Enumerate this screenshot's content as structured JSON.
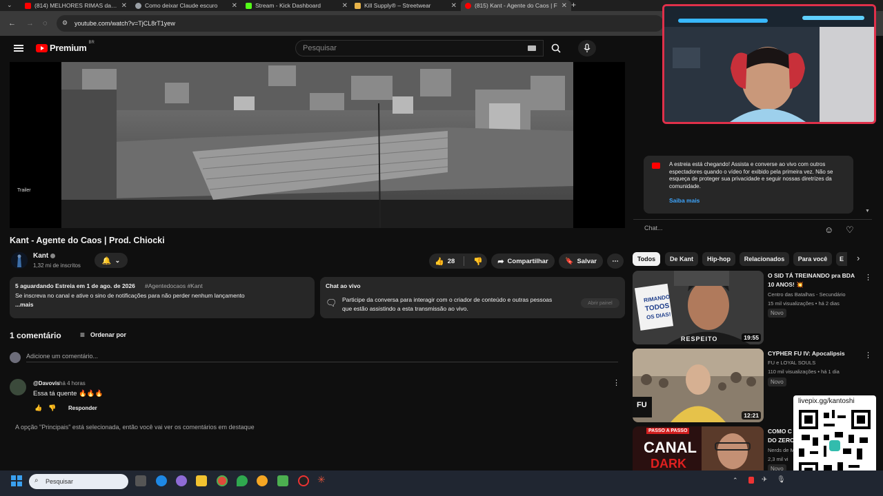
{
  "browser": {
    "tabs": [
      {
        "title": "(814) MELHORES RIMAS da CL",
        "color": "#ff0000"
      },
      {
        "title": "Como deixar Claude escuro",
        "color": "#9aa0a6"
      },
      {
        "title": "Stream - Kick Dashboard",
        "color": "#53fc18"
      },
      {
        "title": "Kill Supply® – Streetwear",
        "color": "#e8b44a"
      },
      {
        "title": "(815) Kant - Agente do Caos | F",
        "color": "#ff0000"
      }
    ],
    "url": "youtube.com/watch?v=TjCL8rT1yew"
  },
  "youtube": {
    "logo_text": "Premium",
    "logo_region": "BR",
    "search_placeholder": "Pesquisar"
  },
  "video": {
    "overlay_label": "Trailer",
    "title": "Kant - Agente do Caos | Prod. Chiocki"
  },
  "channel": {
    "name": "Kant",
    "subscribers": "1,32 mi de inscritos"
  },
  "actions": {
    "likes": "28",
    "share": "Compartilhar",
    "save": "Salvar"
  },
  "description": {
    "line1_bold": "5 aguardando  Estreia em 1 de ago. de 2026",
    "hashtags": "#Agentedocaos #Kant",
    "line2": "Se inscreva no canal e ative o sino de notificações para não perder nenhum lançamento",
    "more": "...mais"
  },
  "live_chat_card": {
    "title": "Chat ao vivo",
    "text_line1": "Participe da conversa para interagir com o criador de conteúdo e outras pessoas",
    "text_line2": "que estão assistindo a esta transmissão ao vivo.",
    "button": "Abrir painel"
  },
  "comments": {
    "count_label": "1 comentário",
    "sort_label": "Ordenar por",
    "add_placeholder": "Adicione um comentário...",
    "items": [
      {
        "author": "@Davovis",
        "time": "há 4 horas",
        "text": "Essa tá quente 🔥🔥🔥",
        "reply": "Responder"
      }
    ],
    "footer_note": "A opção \"Principais\" está selecionada, então você vai ver os comentários em destaque"
  },
  "premiere_notice": {
    "text": "A estreia está chegando! Assista e converse ao vivo com outros espectadores quando o vídeo for exibido pela primeira vez. Não se esqueça de proteger sua privacidade e seguir nossas diretrizes da comunidade.",
    "link": "Saiba mais"
  },
  "chat_input_placeholder": "Chat...",
  "chips": [
    "Todos",
    "De Kant",
    "Hip-hop",
    "Relacionados",
    "Para você",
    "E"
  ],
  "recommended": [
    {
      "title_line1": "O SID TÁ TREINANDO pra BDA",
      "title_line2": "10 ANOS! 💥",
      "channel": "Centro das Batalhas - Secundário",
      "meta": "15 mil visualizações • há 2 dias",
      "badge": "Novo",
      "duration": "19:55",
      "thumb_text1": "RIMANDO",
      "thumb_text2": "TODOS",
      "thumb_text3": "OS DIAS!",
      "thumb_text4": "RESPEITO"
    },
    {
      "title_line1": "CYPHER FU IV: Apocalipsis",
      "title_line2": "",
      "channel": "FU e LOYAL SOULS",
      "meta": "110 mil visualizações • há 1 dia",
      "badge": "Novo",
      "duration": "12:21",
      "thumb_text1": "FU"
    },
    {
      "title_line1": "COMO C",
      "title_line2": "DO ZERO",
      "channel": "Nerds de M",
      "meta": "2,3 mil vi",
      "badge": "Novo",
      "thumb_text1": "PASSO A PASSO",
      "thumb_text2": "CANAL",
      "thumb_text3": "DARK"
    }
  ],
  "overlay": {
    "livepix": "livepix.gg/kantoshi"
  },
  "taskbar": {
    "search_placeholder": "Pesquisar"
  }
}
